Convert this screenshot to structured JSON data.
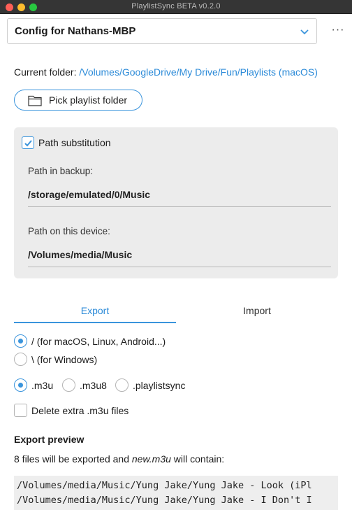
{
  "window": {
    "title": "PlaylistSync BETA v0.2.0"
  },
  "config": {
    "selected": "Config for Nathans-MBP",
    "more_label": "···"
  },
  "current_folder": {
    "label": "Current folder: ",
    "path": "/Volumes/GoogleDrive/My Drive/Fun/Playlists (macOS)"
  },
  "pick_button": {
    "label": "Pick playlist folder",
    "icon": "folder-icon"
  },
  "path_substitution": {
    "enabled": true,
    "label": "Path substitution",
    "backup_label": "Path in backup:",
    "backup_value": "/storage/emulated/0/Music",
    "device_label": "Path on this device:",
    "device_value": "/Volumes/media/Music"
  },
  "tabs": [
    {
      "label": "Export",
      "active": true
    },
    {
      "label": "Import",
      "active": false
    }
  ],
  "separator_options": [
    {
      "label": "/ (for macOS, Linux, Android...)",
      "selected": true
    },
    {
      "label": "\\ (for Windows)",
      "selected": false
    }
  ],
  "format_options": [
    {
      "label": ".m3u",
      "selected": true
    },
    {
      "label": ".m3u8",
      "selected": false
    },
    {
      "label": ".playlistsync",
      "selected": false
    }
  ],
  "delete_extra": {
    "label": "Delete extra .m3u files",
    "checked": false
  },
  "preview": {
    "heading": "Export preview",
    "summary_prefix": "8 files will be exported and ",
    "summary_file": "new.m3u",
    "summary_suffix": " will contain:",
    "lines": [
      "/Volumes/media/Music/Yung Jake/Yung Jake - Look (iPl",
      "/Volumes/media/Music/Yung Jake/Yung Jake - I Don't I"
    ]
  },
  "colors": {
    "accent": "#3a94dc",
    "link": "#2b8ad8",
    "titlebar": "#353535",
    "panel": "#ececec"
  }
}
